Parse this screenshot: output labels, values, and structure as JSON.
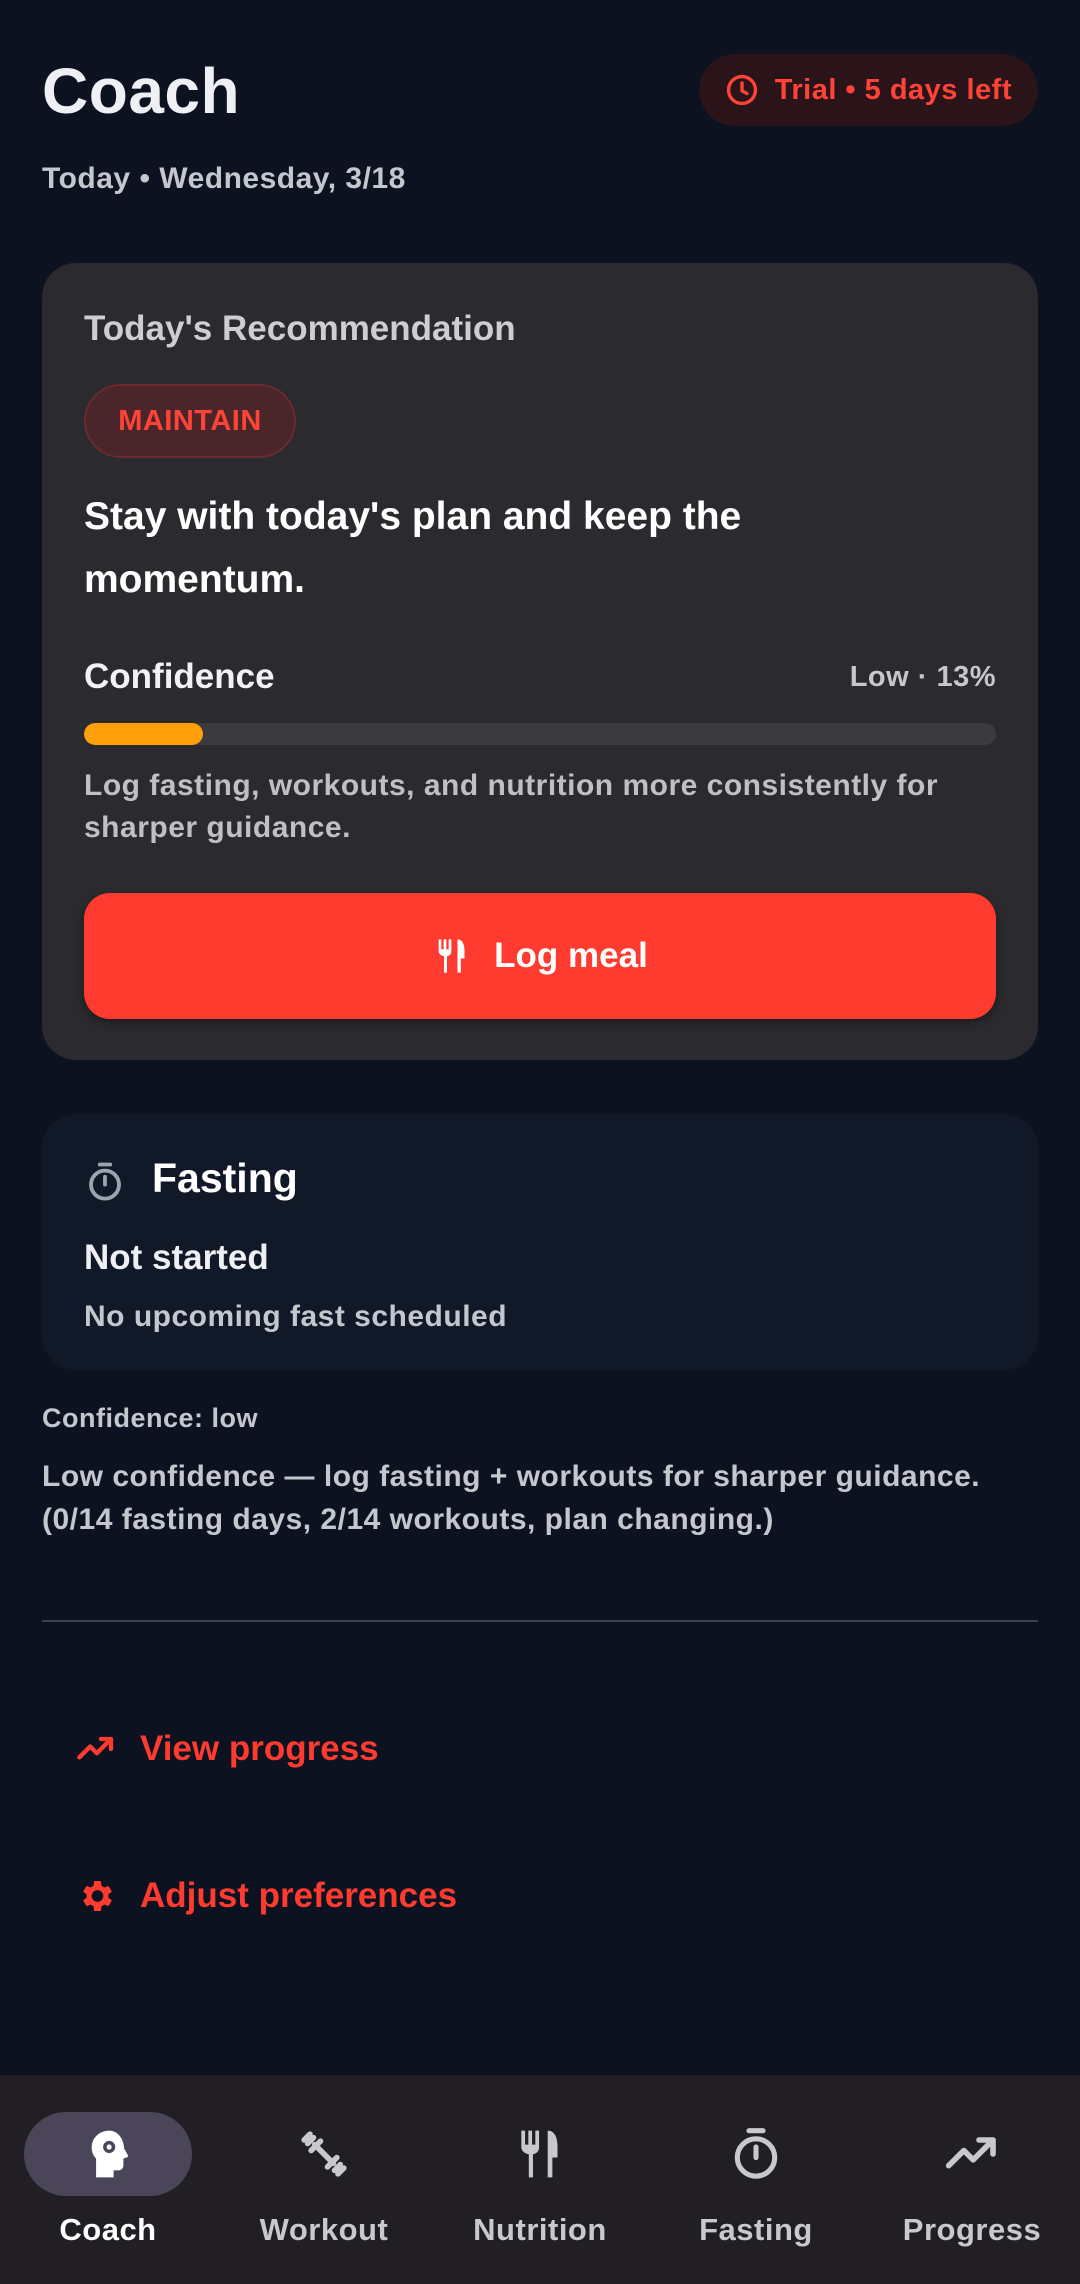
{
  "header": {
    "title": "Coach",
    "date": "Today • Wednesday, 3/18",
    "trial": "Trial • 5 days left",
    "trial_icon": "clock-icon"
  },
  "recommendation": {
    "heading": "Today's Recommendation",
    "badge": "MAINTAIN",
    "text": "Stay with today's plan and keep the momentum.",
    "confidence_label": "Confidence",
    "confidence_value": "Low · 13%",
    "confidence_percent": 13,
    "note": "Log fasting, workouts, and nutrition more consistently for sharper guidance.",
    "button_label": "Log meal",
    "button_icon": "fork-knife-icon"
  },
  "fasting": {
    "icon": "stopwatch-icon",
    "title": "Fasting",
    "status": "Not started",
    "subtitle": "No upcoming fast scheduled"
  },
  "confidence_info": {
    "label": "Confidence: low",
    "description": "Low confidence — log fasting + workouts for sharper guidance. (0/14 fasting days, 2/14 workouts, plan changing.)"
  },
  "links": {
    "progress": {
      "label": "View progress",
      "icon": "trending-up-icon"
    },
    "preferences": {
      "label": "Adjust preferences",
      "icon": "gear-icon"
    }
  },
  "nav": [
    {
      "label": "Coach",
      "icon": "coach-head-icon",
      "active": true
    },
    {
      "label": "Workout",
      "icon": "dumbbell-icon",
      "active": false
    },
    {
      "label": "Nutrition",
      "icon": "fork-knife-icon",
      "active": false
    },
    {
      "label": "Fasting",
      "icon": "stopwatch-icon",
      "active": false
    },
    {
      "label": "Progress",
      "icon": "trending-up-icon",
      "active": false
    }
  ],
  "colors": {
    "background": "#0c1220",
    "accent": "#ff3b30",
    "confidence_bar": "#ff9f0a",
    "card": "#2b2a2e"
  }
}
